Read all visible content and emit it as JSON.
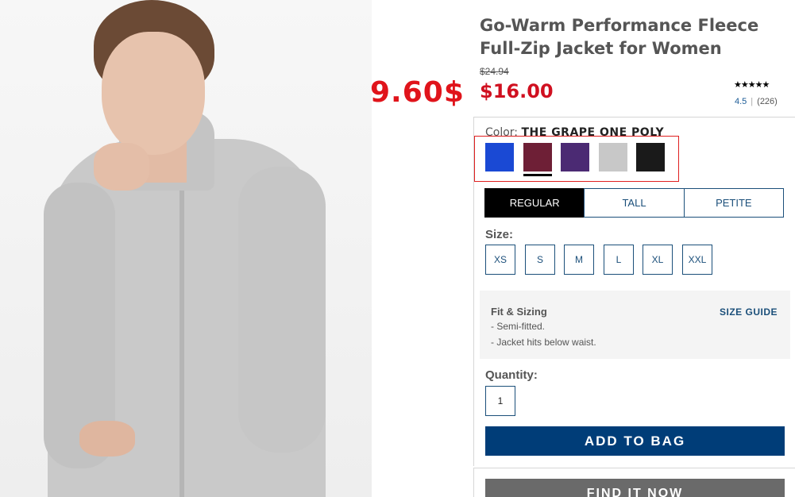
{
  "product": {
    "title": "Go-Warm Performance Fleece Full-Zip Jacket for Women",
    "original_price": "$24.94",
    "sale_price": "$16.00",
    "overlay_price": "9.60$",
    "rating": {
      "stars": "★★★★★",
      "value": "4.5",
      "count": "(226)"
    }
  },
  "color": {
    "label": "Color:",
    "selected_name": "THE GRAPE ONE POLY",
    "swatches": [
      {
        "name": "blue",
        "hex": "#1a49d4"
      },
      {
        "name": "the grape one poly",
        "hex": "#6e1f36"
      },
      {
        "name": "purple",
        "hex": "#4b2a73"
      },
      {
        "name": "light grey",
        "hex": "#c8c8c8"
      },
      {
        "name": "black",
        "hex": "#1a1a1a"
      }
    ]
  },
  "fits": [
    "REGULAR",
    "TALL",
    "PETITE"
  ],
  "size": {
    "label": "Size:",
    "options": [
      "XS",
      "S",
      "M",
      "L",
      "XL",
      "XXL"
    ]
  },
  "fit_sizing": {
    "title": "Fit & Sizing",
    "items": [
      "- Semi-fitted.",
      "- Jacket hits below waist."
    ],
    "size_guide": "SIZE GUIDE"
  },
  "quantity": {
    "label": "Quantity:",
    "value": "1"
  },
  "actions": {
    "add_to_bag": "ADD TO BAG",
    "find_it_now": "FIND IT NOW"
  },
  "colors": {
    "accent_navy": "#003d78",
    "sale_red": "#d01020",
    "overlay_red": "#e0141b"
  }
}
